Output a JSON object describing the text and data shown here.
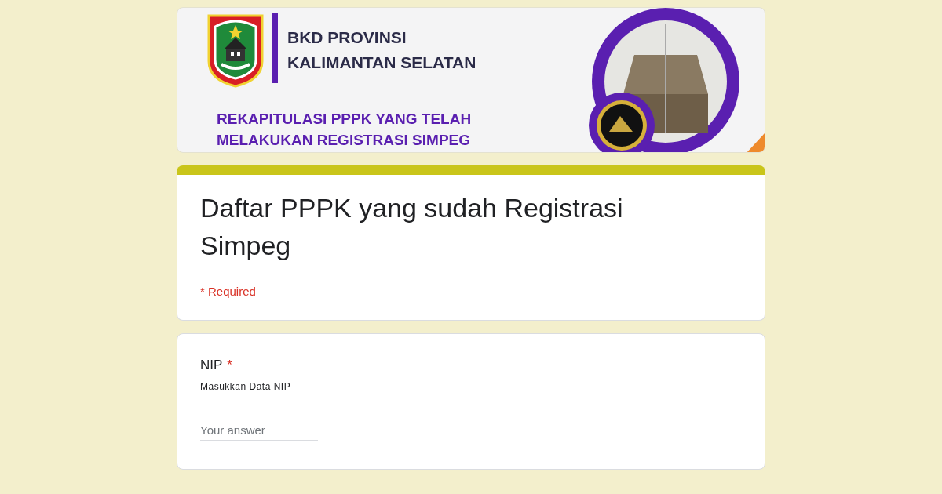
{
  "banner": {
    "heading_lines": [
      "BKD PROVINSI",
      "KALIMANTAN SELATAN"
    ],
    "subtitle_lines": [
      "REKAPITULASI PPPK YANG TELAH",
      "MELAKUKAN REGISTRASI SIMPEG"
    ]
  },
  "form": {
    "title": "Daftar PPPK yang sudah Registrasi Simpeg",
    "required_note": "* Required"
  },
  "questions": [
    {
      "kind": "short_answer",
      "label": "NIP",
      "required": true,
      "required_mark": "*",
      "description": "Masukkan Data NIP",
      "placeholder": "Your answer"
    }
  ]
}
